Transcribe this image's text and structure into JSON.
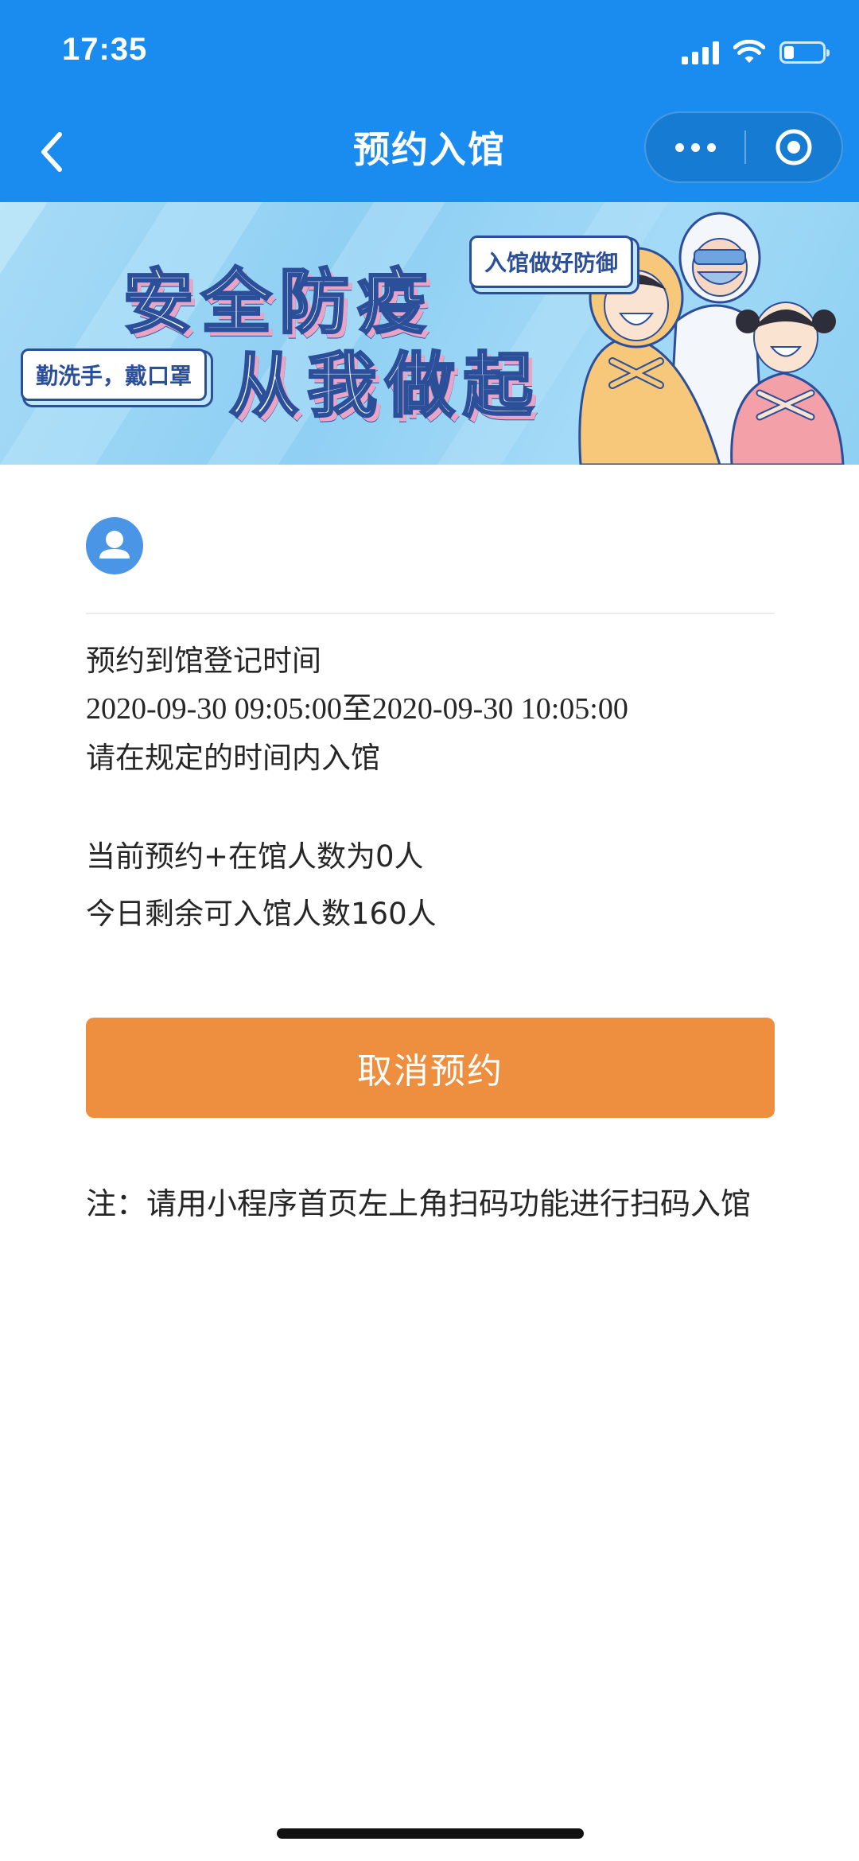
{
  "status_bar": {
    "time": "17:35",
    "battery_level": 0.25
  },
  "nav": {
    "title": "预约入馆",
    "back_icon": "chevron-left-icon",
    "more_icon": "more-dots-icon",
    "close_icon": "target-close-icon"
  },
  "banner": {
    "slogan_line1": "安全防疫",
    "slogan_line2": "从我做起",
    "tag_right": "入馆做好防御",
    "tag_left": "勤洗手，戴口罩"
  },
  "reservation": {
    "heading": "预约到馆登记时间",
    "time_range": "2020-09-30 09:05:00至2020-09-30 10:05:00",
    "instruction": "请在规定的时间内入馆",
    "current_count": "当前预约+在馆人数为0人",
    "remaining": "今日剩余可入馆人数160人"
  },
  "actions": {
    "cancel_label": "取消预约"
  },
  "note": {
    "text": "注：请用小程序首页左上角扫码功能进行扫码入馆"
  },
  "colors": {
    "nav_blue": "#1a8cf0",
    "button_orange": "#ee8f3f",
    "avatar_blue": "#4b95e7"
  }
}
